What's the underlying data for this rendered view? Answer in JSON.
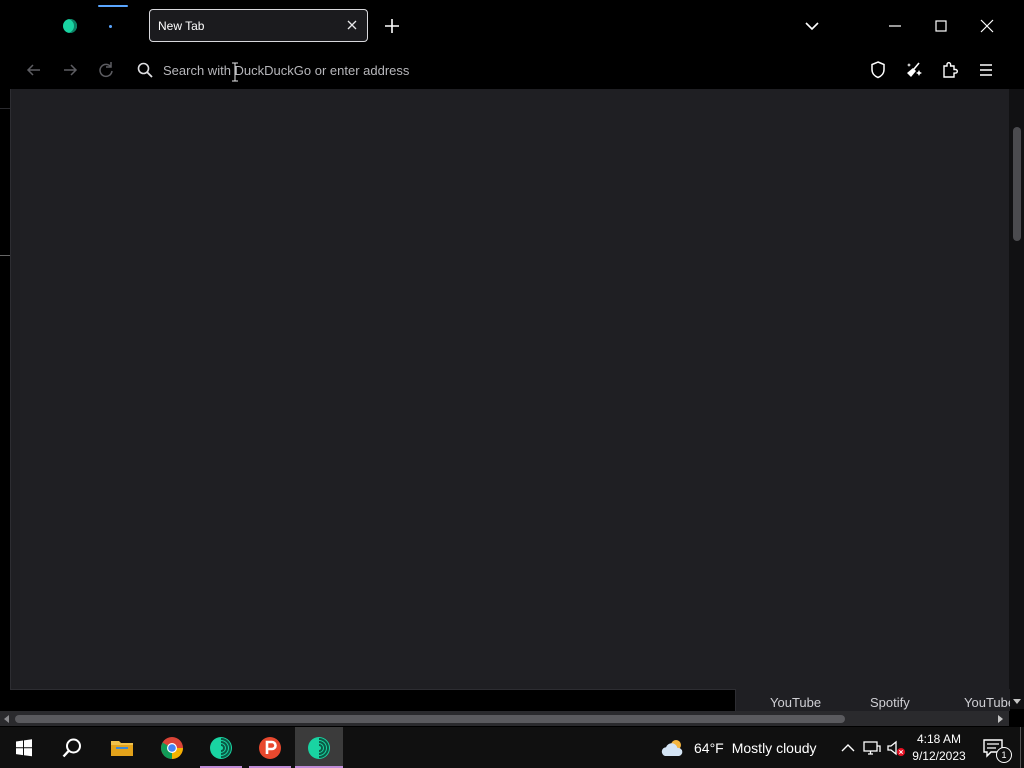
{
  "browser": {
    "tab": {
      "title": "New Tab"
    },
    "urlbar": {
      "placeholder": "Search with DuckDuckGo or enter address"
    },
    "shortcuts": [
      "YouTube",
      "Spotify",
      "YouTube"
    ]
  },
  "taskbar": {
    "apps": [
      "start",
      "search",
      "file-explorer",
      "chrome",
      "tor-browser",
      "psiphon",
      "tor-browser-active"
    ],
    "weather": {
      "temp": "64°F",
      "condition": "Mostly cloudy"
    },
    "clock": {
      "time": "4:18 AM",
      "date": "9/12/2023"
    },
    "notification_count": "1"
  },
  "colors": {
    "accent_tab": "#5aa6ff",
    "tor_green": "#19d4a2",
    "content_bg": "#1f1f23",
    "taskbar_underline": "#c08cd8"
  }
}
